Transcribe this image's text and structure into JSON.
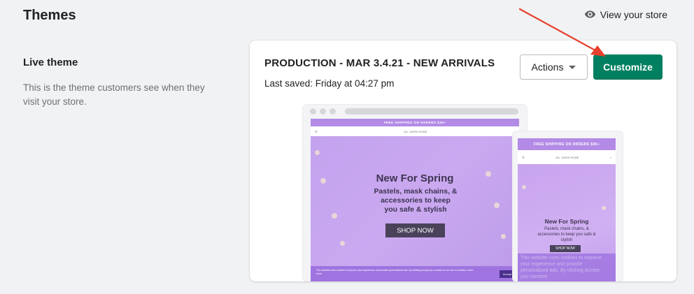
{
  "header": {
    "title": "Themes",
    "view_store_label": "View your store"
  },
  "live_theme_section": {
    "heading": "Live theme",
    "description": "This is the theme customers see when they visit your store."
  },
  "theme_card": {
    "theme_name": "PRODUCTION - MAR 3.4.21 - NEW ARRIVALS",
    "last_saved": "Last saved: Friday at 04:27 pm",
    "actions_label": "Actions",
    "customize_label": "Customize"
  },
  "preview": {
    "promo_text": "FREE SHIPPING ON ORDERS $45+",
    "store_logo": "JILL ZARIN HOME",
    "hero_title": "New For Spring",
    "hero_subtitle": "Pastels, mask chains, & accessories to keep you safe & stylish",
    "shop_now_label": "SHOP NOW",
    "cookie_text": "This website uses cookies to improve your experience and provide personalized ads. By clicking Accept you consent to our use of cookies. Learn more",
    "accept_label": "Accept",
    "mobile_cookie_text": "This website uses cookies to improve your experience and provide personalized ads. By clicking Accept you consent"
  },
  "colors": {
    "primary_button": "#008060",
    "hero_purple": "#c4a2ee",
    "arrow_red": "#e8402f"
  }
}
